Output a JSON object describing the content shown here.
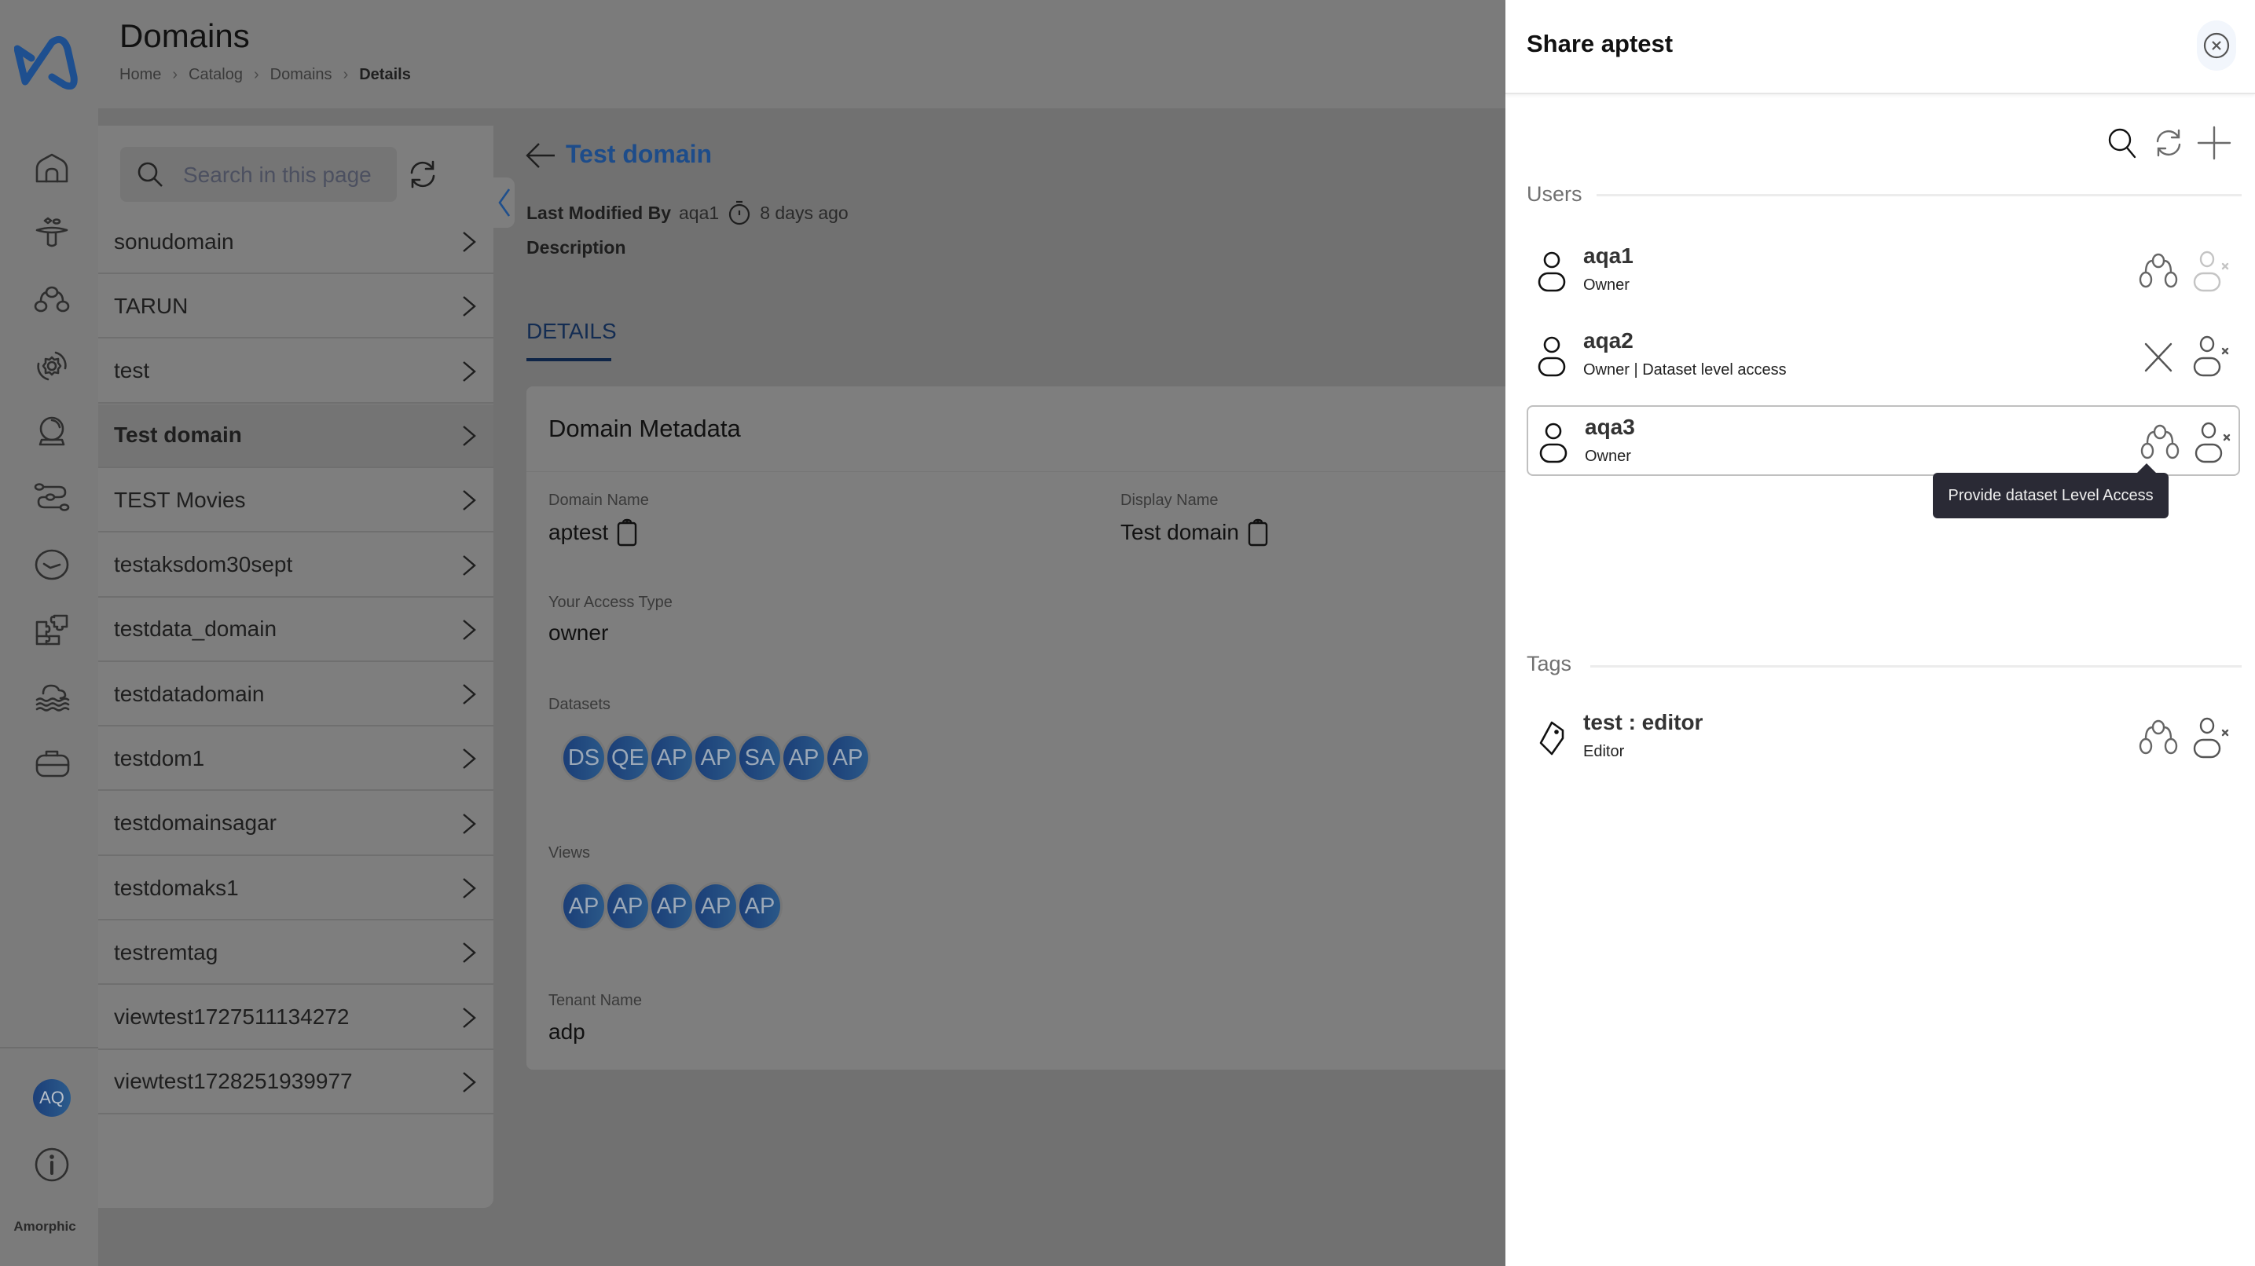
{
  "app": {
    "brand": "Amorphic",
    "user_initials": "AQ",
    "logo_color": "#1e4f8f",
    "accent_color": "#1d4c8a"
  },
  "sidebar": {
    "nav_icons": [
      "home-icon",
      "ingestion-funnel-icon",
      "datasets-hierarchy-icon",
      "settings-gear-cycle-icon",
      "crystal-ball-insights-icon",
      "pipeline-path-icon",
      "schedules-clock-icon",
      "integrations-puzzle-icon",
      "data-lake-icon",
      "toolbox-icon"
    ],
    "info_icon": "info-icon"
  },
  "header": {
    "title": "Domains",
    "breadcrumb": [
      "Home",
      "Catalog",
      "Domains",
      "Details"
    ]
  },
  "list": {
    "search_placeholder": "Search in this page",
    "search_value": "",
    "items": [
      {
        "label": "sonudomain",
        "active": false
      },
      {
        "label": "TARUN",
        "active": false
      },
      {
        "label": "test",
        "active": false
      },
      {
        "label": "Test domain",
        "active": true
      },
      {
        "label": "TEST Movies",
        "active": false
      },
      {
        "label": "testaksdom30sept",
        "active": false
      },
      {
        "label": "testdata_domain",
        "active": false
      },
      {
        "label": "testdatadomain",
        "active": false
      },
      {
        "label": "testdom1",
        "active": false
      },
      {
        "label": "testdomainsagar",
        "active": false
      },
      {
        "label": "testdomaks1",
        "active": false
      },
      {
        "label": "testremtag",
        "active": false
      },
      {
        "label": "viewtest1727511134272",
        "active": false
      },
      {
        "label": "viewtest1728251939977",
        "active": false
      }
    ]
  },
  "detail": {
    "title": "Test domain",
    "last_modified_label": "Last Modified By",
    "last_modified_by": "aqa1",
    "last_modified_time": "8 days ago",
    "description_label": "Description",
    "tabs": [
      {
        "label": "DETAILS",
        "active": true
      }
    ],
    "card": {
      "title": "Domain Metadata",
      "domain_name_label": "Domain Name",
      "domain_name": "aptest",
      "display_name_label": "Display Name",
      "display_name": "Test domain",
      "access_type_label": "Your Access Type",
      "access_type": "owner",
      "datasets_label": "Datasets",
      "datasets": [
        "DS",
        "QE",
        "AP",
        "AP",
        "SA",
        "AP",
        "AP"
      ],
      "views_label": "Views",
      "views": [
        "AP",
        "AP",
        "AP",
        "AP",
        "AP"
      ],
      "tenant_label": "Tenant Name",
      "tenant": "adp"
    }
  },
  "share": {
    "title": "Share aptest",
    "users_label": "Users",
    "tags_label": "Tags",
    "users": [
      {
        "name": "aqa1",
        "role": "Owner",
        "action1": "provide-dataset-access",
        "remove_disabled": true
      },
      {
        "name": "aqa2",
        "role": "Owner | Dataset level access",
        "action1": "revoke-dataset-access",
        "remove_disabled": false
      },
      {
        "name": "aqa3",
        "role": "Owner",
        "action1": "provide-dataset-access",
        "remove_disabled": false
      }
    ],
    "tags": [
      {
        "name": "test : editor",
        "role": "Editor"
      }
    ],
    "tooltip": "Provide dataset Level Access"
  }
}
